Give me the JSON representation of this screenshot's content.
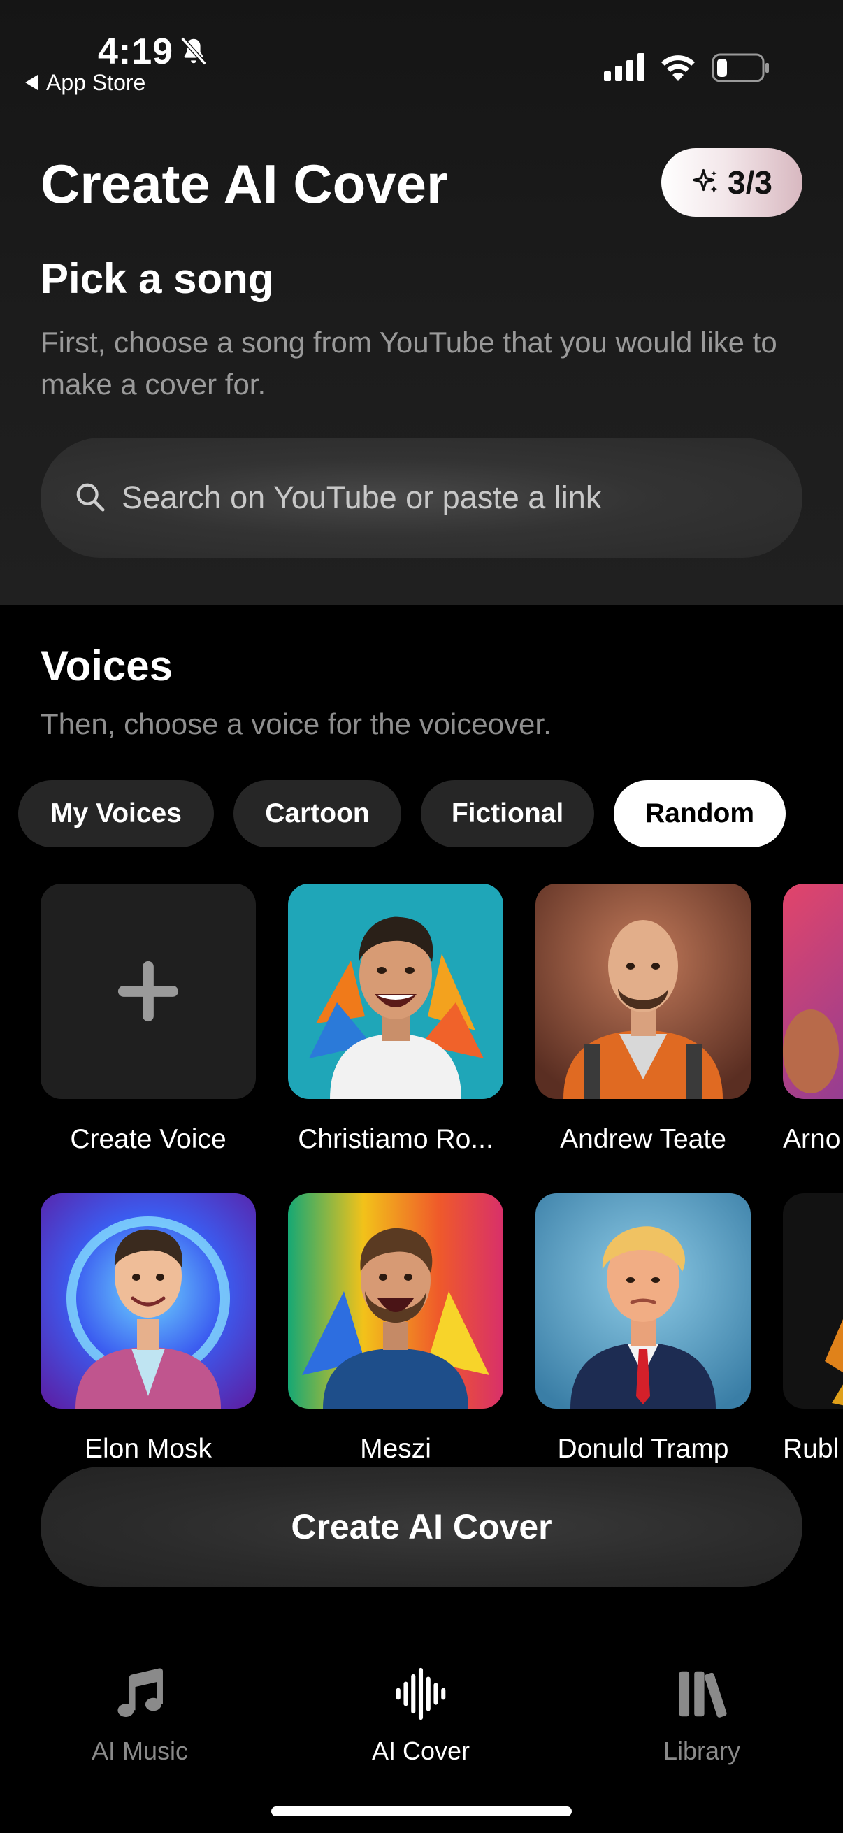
{
  "status_bar": {
    "time": "4:19",
    "back_app": "App Store"
  },
  "header": {
    "title": "Create AI Cover",
    "credits": "3/3"
  },
  "song_section": {
    "title": "Pick a song",
    "description": "First, choose a song from YouTube that you would like to make a cover for.",
    "search_placeholder": "Search on YouTube or paste a link"
  },
  "voices_section": {
    "title": "Voices",
    "description": "Then, choose a voice for the voiceover.",
    "tabs": [
      {
        "label": "My Voices",
        "active": false
      },
      {
        "label": "Cartoon",
        "active": false
      },
      {
        "label": "Fictional",
        "active": false
      },
      {
        "label": "Random",
        "active": true
      }
    ],
    "cards": [
      {
        "label": "Create Voice",
        "icon": "plus-icon"
      },
      {
        "label": "Christiamo Ro..."
      },
      {
        "label": "Andrew Teate"
      },
      {
        "label": "Arno"
      },
      {
        "label": "Elon Mosk"
      },
      {
        "label": "Meszi"
      },
      {
        "label": "Donuld Tramp"
      },
      {
        "label": "Rubl"
      }
    ]
  },
  "primary_action": {
    "label": "Create AI Cover"
  },
  "tab_bar": {
    "items": [
      {
        "label": "AI Music",
        "icon": "music-note-icon",
        "active": false
      },
      {
        "label": "AI Cover",
        "icon": "waveform-icon",
        "active": true
      },
      {
        "label": "Library",
        "icon": "library-icon",
        "active": false
      }
    ]
  },
  "colors": {
    "background": "#000000",
    "inactive_tab": "#262626",
    "active_tab": "#ffffff",
    "muted_text": "#9a9a9a",
    "tabbar_inactive": "#8a8a8a"
  }
}
